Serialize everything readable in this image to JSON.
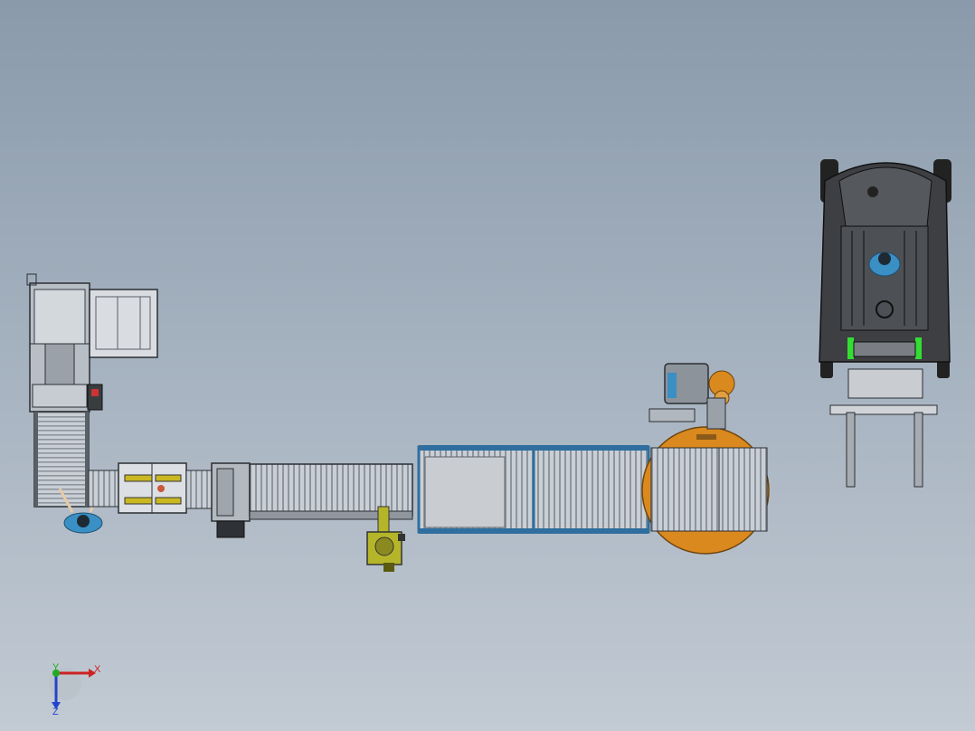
{
  "scene": {
    "background_top": "#8a9aab",
    "background_bottom": "#c2cad3",
    "accent_orange": "#d9891e",
    "accent_blue": "#2f6e9e",
    "accent_green": "#33dd33",
    "robot_yellow": "#b5b52a",
    "operator_blue": "#3a8fc4"
  },
  "triad": {
    "x_label": "X",
    "y_label": "Y",
    "z_label": "Z",
    "x_color": "#cc2222",
    "y_color": "#22aa22",
    "z_color": "#2244cc"
  }
}
